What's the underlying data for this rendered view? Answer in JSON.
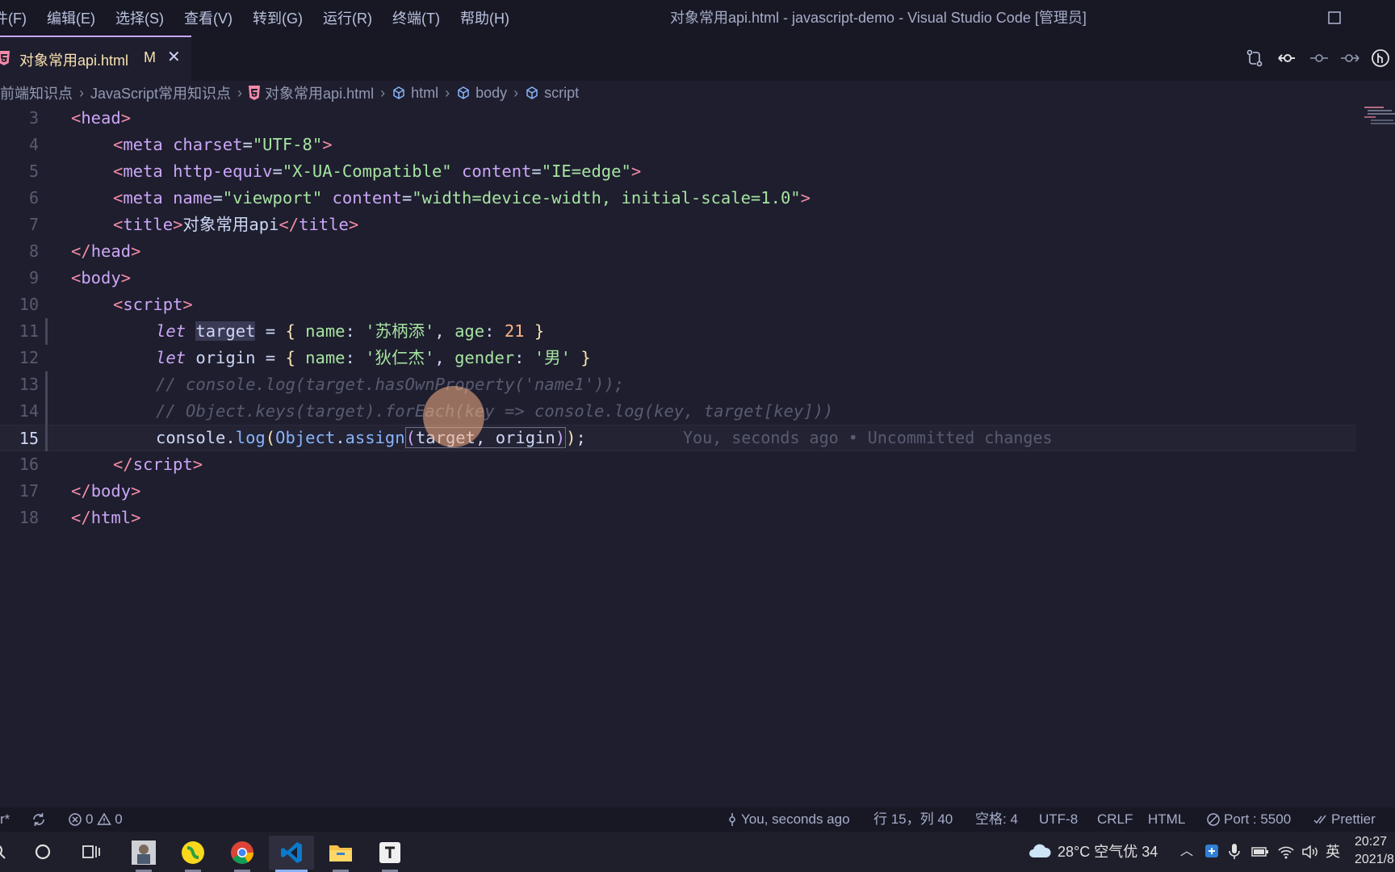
{
  "menu": {
    "items": [
      "件(F)",
      "编辑(E)",
      "选择(S)",
      "查看(V)",
      "转到(G)",
      "运行(R)",
      "终端(T)",
      "帮助(H)"
    ]
  },
  "window": {
    "title": "对象常用api.html - javascript-demo - Visual Studio Code [管理员]"
  },
  "tab": {
    "label": "对象常用api.html",
    "modified": "M",
    "close": "✕"
  },
  "breadcrumb": {
    "items": [
      "前端知识点",
      "JavaScript常用知识点",
      "对象常用api.html",
      "html",
      "body",
      "script"
    ]
  },
  "editor": {
    "line_numbers": [
      "3",
      "4",
      "5",
      "6",
      "7",
      "8",
      "9",
      "10",
      "11",
      "12",
      "13",
      "14",
      "15",
      "16",
      "17",
      "18"
    ],
    "current_line": "15",
    "blame": "You, seconds ago • Uncommitted changes"
  },
  "code": {
    "l3": [
      "<",
      "head",
      ">"
    ],
    "l4": [
      "<",
      "meta",
      "charset",
      "=",
      "\"UTF-8\"",
      ">"
    ],
    "l5": [
      "<",
      "meta",
      "http-equiv",
      "=",
      "\"X-UA-Compatible\"",
      "content",
      "=",
      "\"IE=edge\"",
      ">"
    ],
    "l6": [
      "<",
      "meta",
      "name",
      "=",
      "\"viewport\"",
      "content",
      "=",
      "\"width=device-width, initial-scale=1.0\"",
      ">"
    ],
    "l7": [
      "<",
      "title",
      ">",
      "对象常用api",
      "</",
      "title",
      ">"
    ],
    "l8": [
      "</",
      "head",
      ">"
    ],
    "l9": [
      "<",
      "body",
      ">"
    ],
    "l10": [
      "<",
      "script",
      ">"
    ],
    "l11": [
      "let",
      "target",
      "=",
      "{",
      "name",
      ":",
      "'苏柄添'",
      ",",
      "age",
      ":",
      "21",
      "}"
    ],
    "l12": [
      "let",
      "origin",
      "=",
      "{",
      "name",
      ":",
      "'狄仁杰'",
      ",",
      "gender",
      ":",
      "'男'",
      "}"
    ],
    "l13": "// console.log(target.hasOwnProperty('name1'));",
    "l14": "// Object.keys(target).forEach(key => console.log(key, target[key]))",
    "l15": [
      "console",
      ".",
      "log",
      "(",
      "Object",
      ".",
      "assign",
      "(",
      "target",
      ", ",
      "origin",
      ")",
      ")",
      ";"
    ],
    "l16": [
      "</",
      "script",
      ">"
    ],
    "l17": [
      "</",
      "body",
      ">"
    ],
    "l18": [
      "</",
      "html",
      ">"
    ]
  },
  "status": {
    "left_fragment": "r*",
    "errors": "0",
    "warnings": "0",
    "blame": "You, seconds ago",
    "position": "行 15，列 40",
    "spaces": "空格: 4",
    "encoding": "UTF-8",
    "eol": "CRLF",
    "language": "HTML",
    "port": "Port : 5500",
    "formatter": "Prettier"
  },
  "taskbar": {
    "weather": "28°C 空气优 34",
    "ime": "英",
    "time": "20:27",
    "date": "2021/8"
  },
  "colors": {
    "accent": "#cba6f7",
    "modified": "#f9e2af",
    "background": "#1e1e2e"
  }
}
